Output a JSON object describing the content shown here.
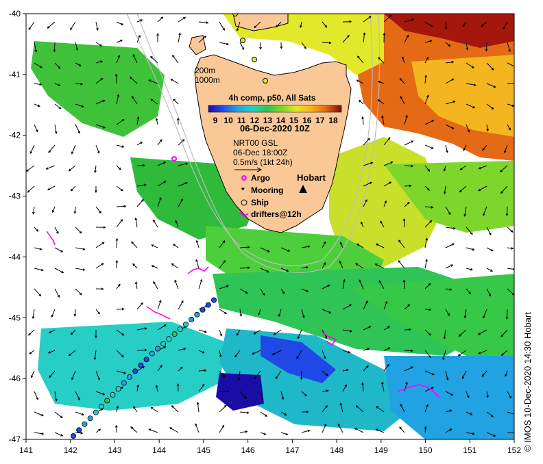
{
  "map": {
    "type": "sea-surface-temperature-map",
    "region": "Tasmania",
    "lon_range": [
      141,
      152
    ],
    "lat_range": [
      -47,
      -40
    ],
    "x_ticks": [
      "141",
      "142",
      "143",
      "144",
      "145",
      "146",
      "147",
      "148",
      "149",
      "150",
      "151",
      "152"
    ],
    "y_ticks": [
      "-40",
      "-41",
      "-42",
      "-43",
      "-44",
      "-45",
      "-46",
      "-47"
    ],
    "land_color": "#f9c896",
    "isobaths": [
      "200m",
      "1000m"
    ]
  },
  "legend": {
    "title": "4h comp, p50, All Sats",
    "scale_ticks": [
      "9",
      "10",
      "11",
      "12",
      "13",
      "14",
      "15",
      "16",
      "17",
      "18"
    ],
    "scale_colors": [
      "#1a0da6",
      "#1f48e6",
      "#21a3e3",
      "#27cec6",
      "#2fc456",
      "#7ed62b",
      "#e3e82a",
      "#f5b51e",
      "#e46a16",
      "#a3170d",
      "#7a0c0c"
    ],
    "date": "06-Dec-2020 10Z",
    "current_source": "NRT00 GSL",
    "current_time": "06-Dec 18:00Z",
    "current_scale": "0.5m/s (1kt 24h)",
    "items": [
      {
        "label": "Argo",
        "color": "#ff00ff",
        "icon": "argo-ring-icon"
      },
      {
        "label": "Mooring",
        "color": "#000000",
        "icon": "mooring-star-icon"
      },
      {
        "label": "Ship",
        "color": "#000000",
        "icon": "ship-circle-icon"
      },
      {
        "label": "drifters@12h",
        "color": "#ff00ff",
        "icon": "drifter-track-icon"
      }
    ]
  },
  "places": [
    {
      "name": "Hobart",
      "lon": 147.3,
      "lat": -42.88
    }
  ],
  "credit": "© IMOS 10-Dec-2020 14:30 Hobart"
}
